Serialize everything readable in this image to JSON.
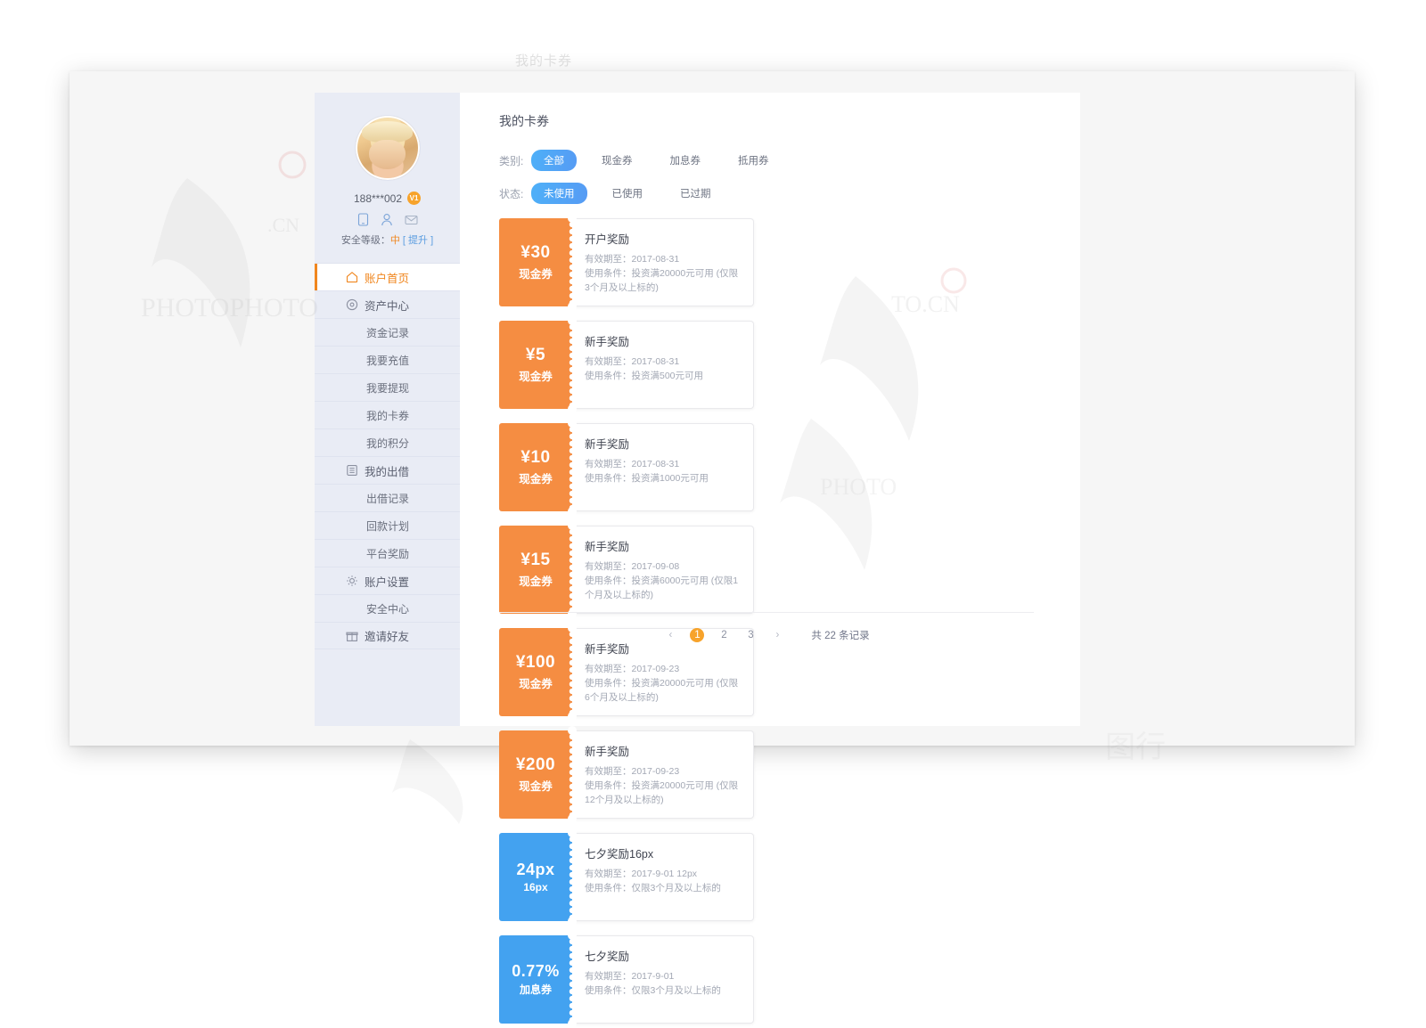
{
  "ghost_title": "我的卡券",
  "sidebar": {
    "user_id": "188***002",
    "vip_badge": "V1",
    "icons": [
      "phone-icon",
      "person-icon",
      "mail-icon"
    ],
    "security_prefix": "安全等级：",
    "security_level": "中",
    "security_upgrade": "[ 提升 ]",
    "nav": [
      {
        "label": "账户首页",
        "icon": "home-icon",
        "type": "group",
        "active": true
      },
      {
        "label": "资产中心",
        "icon": "circle-dot-icon",
        "type": "group",
        "active": false
      },
      {
        "label": "资金记录",
        "icon": "",
        "type": "sub",
        "active": false
      },
      {
        "label": "我要充值",
        "icon": "",
        "type": "sub",
        "active": false
      },
      {
        "label": "我要提现",
        "icon": "",
        "type": "sub",
        "active": false
      },
      {
        "label": "我的卡券",
        "icon": "",
        "type": "sub",
        "active": false
      },
      {
        "label": "我的积分",
        "icon": "",
        "type": "sub",
        "active": false
      },
      {
        "label": "我的出借",
        "icon": "list-icon",
        "type": "group",
        "active": false
      },
      {
        "label": "出借记录",
        "icon": "",
        "type": "sub",
        "active": false
      },
      {
        "label": "回款计划",
        "icon": "",
        "type": "sub",
        "active": false
      },
      {
        "label": "平台奖励",
        "icon": "",
        "type": "sub",
        "active": false
      },
      {
        "label": "账户设置",
        "icon": "gear-icon",
        "type": "group",
        "active": false
      },
      {
        "label": "安全中心",
        "icon": "",
        "type": "sub",
        "active": false
      },
      {
        "label": "邀请好友",
        "icon": "gift-icon",
        "type": "group",
        "active": false
      }
    ]
  },
  "main": {
    "title": "我的卡券",
    "filters": [
      {
        "label": "类别:",
        "options": [
          {
            "text": "全部",
            "active": true
          },
          {
            "text": "现金券",
            "active": false
          },
          {
            "text": "加息券",
            "active": false
          },
          {
            "text": "抵用券",
            "active": false
          }
        ]
      },
      {
        "label": "状态:",
        "options": [
          {
            "text": "未使用",
            "active": true
          },
          {
            "text": "已使用",
            "active": false
          },
          {
            "text": "已过期",
            "active": false
          }
        ]
      }
    ],
    "coupons": [
      {
        "amount": "¥30",
        "kind": "现金券",
        "color": "orange",
        "title": "开户奖励",
        "expiry": "有效期至：2017-08-31",
        "condition": "使用条件：投资满20000元可用 (仅限3个月及以上标的)"
      },
      {
        "amount": "¥5",
        "kind": "现金券",
        "color": "orange",
        "title": "新手奖励",
        "expiry": "有效期至：2017-08-31",
        "condition": "使用条件：投资满500元可用"
      },
      {
        "amount": "¥10",
        "kind": "现金券",
        "color": "orange",
        "title": "新手奖励",
        "expiry": "有效期至：2017-08-31",
        "condition": "使用条件：投资满1000元可用"
      },
      {
        "amount": "¥15",
        "kind": "现金券",
        "color": "orange",
        "title": "新手奖励",
        "expiry": "有效期至：2017-09-08",
        "condition": "使用条件：投资满6000元可用 (仅限1个月及以上标的)"
      },
      {
        "amount": "¥100",
        "kind": "现金券",
        "color": "orange",
        "title": "新手奖励",
        "expiry": "有效期至：2017-09-23",
        "condition": "使用条件：投资满20000元可用 (仅限6个月及以上标的)"
      },
      {
        "amount": "¥200",
        "kind": "现金券",
        "color": "orange",
        "title": "新手奖励",
        "expiry": "有效期至：2017-09-23",
        "condition": "使用条件：投资满20000元可用 (仅限12个月及以上标的)"
      },
      {
        "amount": "24px",
        "kind": "16px",
        "color": "blue",
        "title": "七夕奖励16px",
        "expiry": "有效期至：2017-9-01 12px",
        "condition": "使用条件：仅限3个月及以上标的"
      },
      {
        "amount": "0.77%",
        "kind": "加息券",
        "color": "blue",
        "title": "七夕奖励",
        "expiry": "有效期至：2017-9-01",
        "condition": "使用条件：仅限3个月及以上标的"
      }
    ],
    "pagination": {
      "prev": "‹",
      "pages": [
        "1",
        "2",
        "3"
      ],
      "current": "1",
      "next": "›",
      "total_text": "共 22 条记录"
    }
  },
  "colors": {
    "orange": "#f58d42",
    "blue": "#43a2f0",
    "accent": "#f0861e",
    "pill_active": "#4eb0f8",
    "sidebar_bg": "#e9ecf5"
  }
}
